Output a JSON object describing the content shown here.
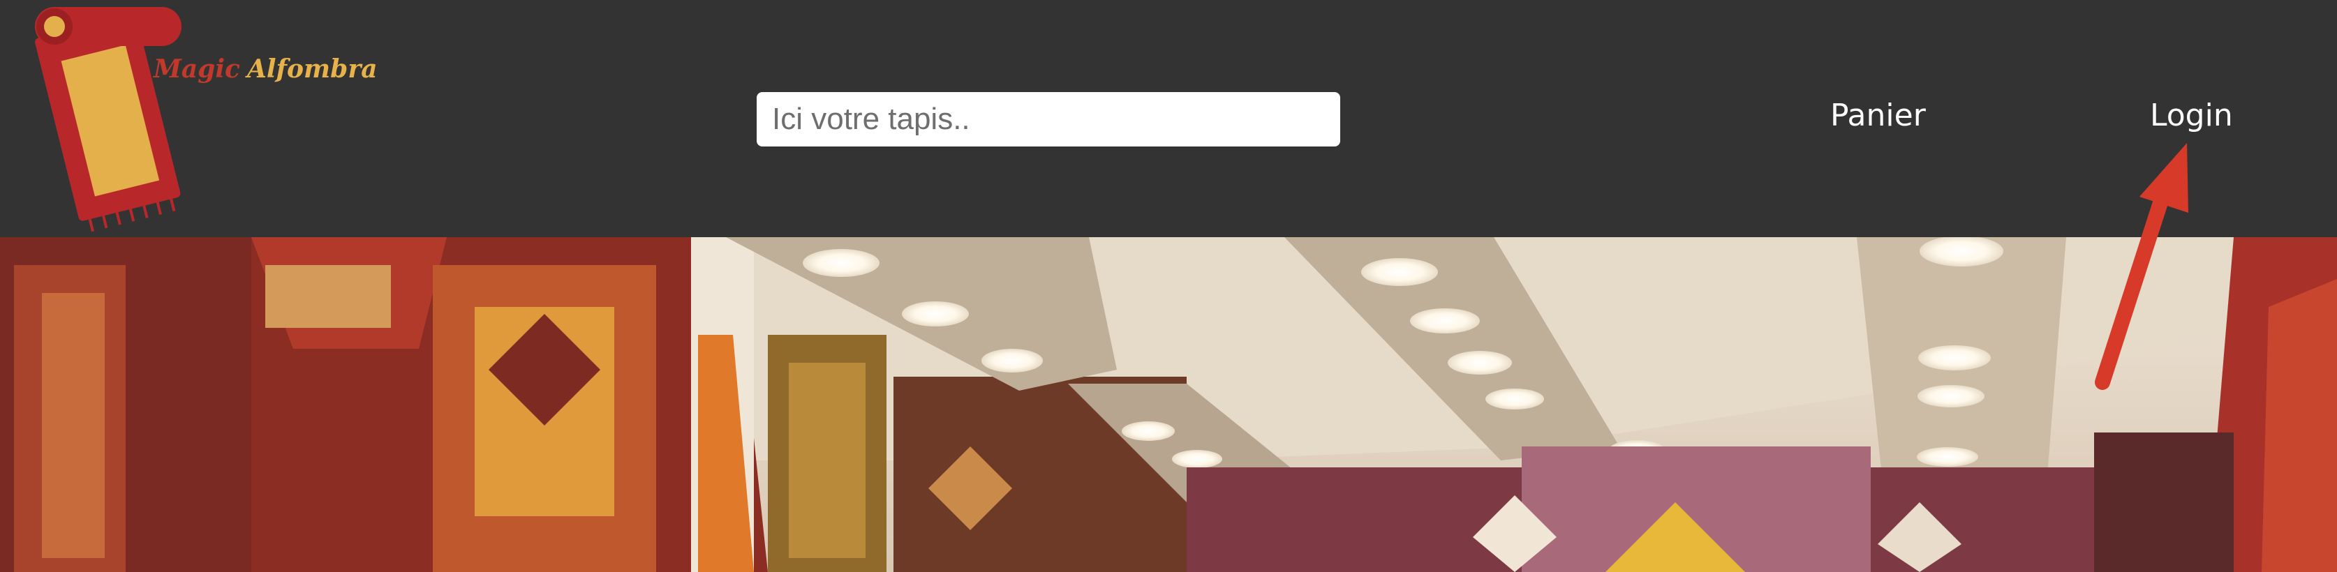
{
  "brand": {
    "word1": "Magic",
    "word2": "Alfombra",
    "colors": {
      "red": "#c0392b",
      "gold": "#e8b24a"
    }
  },
  "search": {
    "placeholder": "Ici votre tapis..",
    "value": ""
  },
  "nav": {
    "cart_label": "Panier",
    "login_label": "Login"
  },
  "colors": {
    "header_bg": "#333333",
    "arrow": "#d83a2a"
  },
  "hero": {
    "icon": "carpet-shop-photo"
  }
}
